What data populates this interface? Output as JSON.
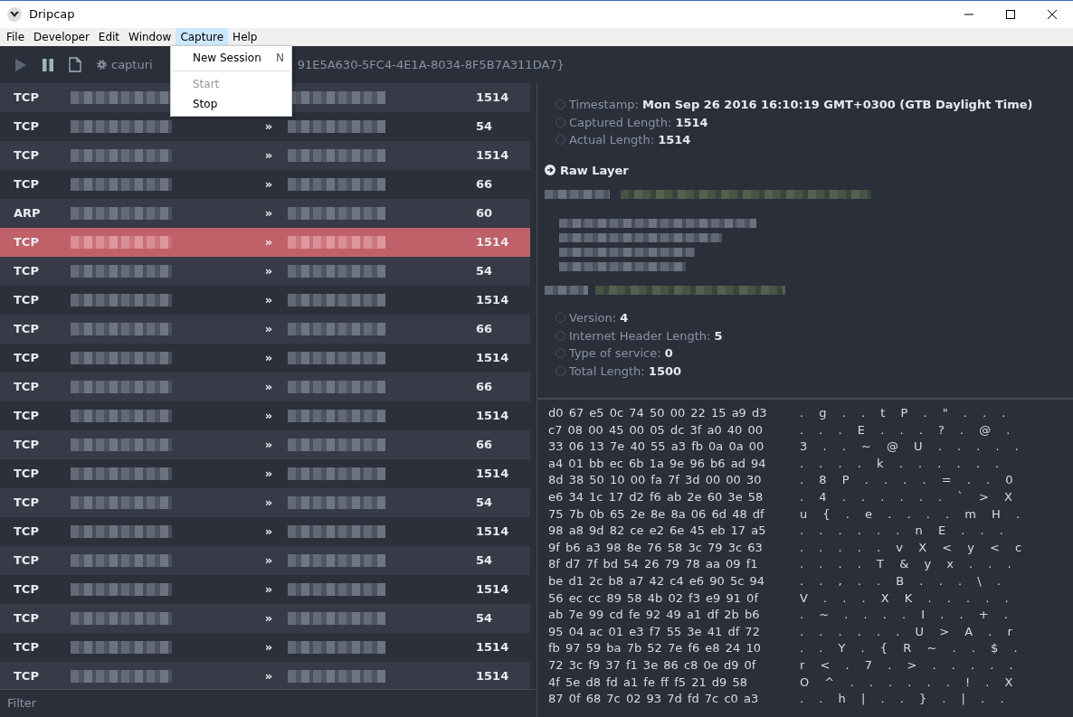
{
  "window": {
    "title": "Dripcap"
  },
  "menu_bar": [
    {
      "label": "File",
      "selected": false
    },
    {
      "label": "Developer",
      "selected": false
    },
    {
      "label": "Edit",
      "selected": false
    },
    {
      "label": "Window",
      "selected": false
    },
    {
      "label": "Capture",
      "selected": true
    },
    {
      "label": "Help",
      "selected": false
    }
  ],
  "capture_menu": [
    {
      "kind": "item",
      "label": "New Session",
      "shortcut": "N",
      "disabled": false
    },
    {
      "kind": "divider"
    },
    {
      "kind": "item",
      "label": "Start",
      "disabled": true
    },
    {
      "kind": "item",
      "label": "Stop",
      "disabled": false
    }
  ],
  "toolbar": {
    "status": "capturi",
    "interface": "91E5A630-5FC4-4E1A-8034-8F5B7A311DA7}"
  },
  "packets": [
    {
      "protocol": "TCP",
      "length": "1514",
      "selected": false
    },
    {
      "protocol": "TCP",
      "arrow": "»",
      "length": "54",
      "selected": false
    },
    {
      "protocol": "TCP",
      "arrow": "»",
      "length": "1514",
      "selected": false
    },
    {
      "protocol": "TCP",
      "arrow": "»",
      "length": "66",
      "selected": false
    },
    {
      "protocol": "ARP",
      "arrow": "»",
      "length": "60",
      "selected": false
    },
    {
      "protocol": "TCP",
      "arrow": "»",
      "length": "1514",
      "selected": true
    },
    {
      "protocol": "TCP",
      "arrow": "»",
      "length": "54",
      "selected": false
    },
    {
      "protocol": "TCP",
      "arrow": "»",
      "length": "1514",
      "selected": false
    },
    {
      "protocol": "TCP",
      "arrow": "»",
      "length": "66",
      "selected": false
    },
    {
      "protocol": "TCP",
      "arrow": "»",
      "length": "1514",
      "selected": false
    },
    {
      "protocol": "TCP",
      "arrow": "»",
      "length": "66",
      "selected": false
    },
    {
      "protocol": "TCP",
      "arrow": "»",
      "length": "1514",
      "selected": false
    },
    {
      "protocol": "TCP",
      "arrow": "»",
      "length": "66",
      "selected": false
    },
    {
      "protocol": "TCP",
      "arrow": "»",
      "length": "1514",
      "selected": false
    },
    {
      "protocol": "TCP",
      "arrow": "»",
      "length": "54",
      "selected": false
    },
    {
      "protocol": "TCP",
      "arrow": "»",
      "length": "1514",
      "selected": false
    },
    {
      "protocol": "TCP",
      "arrow": "»",
      "length": "54",
      "selected": false
    },
    {
      "protocol": "TCP",
      "arrow": "»",
      "length": "1514",
      "selected": false
    },
    {
      "protocol": "TCP",
      "arrow": "»",
      "length": "54",
      "selected": false
    },
    {
      "protocol": "TCP",
      "arrow": "»",
      "length": "1514",
      "selected": false
    },
    {
      "protocol": "TCP",
      "arrow": "»",
      "length": "1514",
      "selected": false
    }
  ],
  "filter": {
    "placeholder": "Filter"
  },
  "summary": [
    {
      "label": "Timestamp:",
      "value": "Mon Sep 26 2016 16:10:19 GMT+0300 (GTB Daylight Time)"
    },
    {
      "label": "Captured Length:",
      "value": "1514"
    },
    {
      "label": "Actual Length:",
      "value": "1514"
    }
  ],
  "layer_title": "Raw Layer",
  "ip_fields": [
    {
      "label": "Version:",
      "value": "4"
    },
    {
      "label": "Internet Header Length:",
      "value": "5"
    },
    {
      "label": "Type of service:",
      "value": "0"
    },
    {
      "label": "Total Length:",
      "value": "1500"
    }
  ],
  "hex_dump": [
    {
      "hex": "d0 67 e5 0c 74 50 00 22 15 a9 d3",
      "ascii": ". g . . t P . \" . . ."
    },
    {
      "hex": "c7 08 00 45 00 05 dc 3f a0 40 00",
      "ascii": ". . . E . . . ? . @ ."
    },
    {
      "hex": "33 06 13 7e 40 55 a3 fb 0a 0a 00",
      "ascii": "3 . . ~ @ U . . . . ."
    },
    {
      "hex": "a4 01 bb ec 6b 1a 9e 96 b6 ad 94",
      "ascii": ". . . . k . . . . . ."
    },
    {
      "hex": "8d 38 50 10 00 fa 7f 3d 00 00 30",
      "ascii": ". 8 P . . . . = . . 0"
    },
    {
      "hex": "e6 34 1c 17 d2 f6 ab 2e 60 3e 58",
      "ascii": ". 4 . . . . . . ` > X"
    },
    {
      "hex": "75 7b 0b 65 2e 8e 8a 06 6d 48 df",
      "ascii": "u { . e . . . . m H ."
    },
    {
      "hex": "98 a8 9d 82 ce e2 6e 45 eb 17 a5",
      "ascii": ". . . . . . n E . . ."
    },
    {
      "hex": "9f b6 a3 98 8e 76 58 3c 79 3c 63",
      "ascii": ". . . . . v X < y < c"
    },
    {
      "hex": "8f d7 7f bd 54 26 79 78 aa 09 f1",
      "ascii": ". . . . T & y x . . ."
    },
    {
      "hex": "be d1 2c b8 a7 42 c4 e6 90 5c 94",
      "ascii": ". . , . . B . . . \\ ."
    },
    {
      "hex": "56 ec cc 89 58 4b 02 f3 e9 91 0f",
      "ascii": "V . . . X K . . . . ."
    },
    {
      "hex": "ab 7e 99 cd fe 92 49 a1 df 2b b6",
      "ascii": ". ~ . . . . I . . + ."
    },
    {
      "hex": "95 04 ac 01 e3 f7 55 3e 41 df 72",
      "ascii": ". . . . . . U > A . r"
    },
    {
      "hex": "fb 97 59 ba 7b 52 7e f6 e8 24 10",
      "ascii": ". . Y . { R ~ . . $ ."
    },
    {
      "hex": "72 3c f9 37 f1 3e 86 c8 0e d9 0f",
      "ascii": "r < . 7 . > . . . . ."
    },
    {
      "hex": "4f 5e d8 fd a1 fe ff f5 21 d9 58",
      "ascii": "O ^ . . . . . . ! . X"
    },
    {
      "hex": "87 0f 68 7c 02 93 7d fd 7c c0 a3",
      "ascii": ". . h | . . } . | . ."
    }
  ]
}
